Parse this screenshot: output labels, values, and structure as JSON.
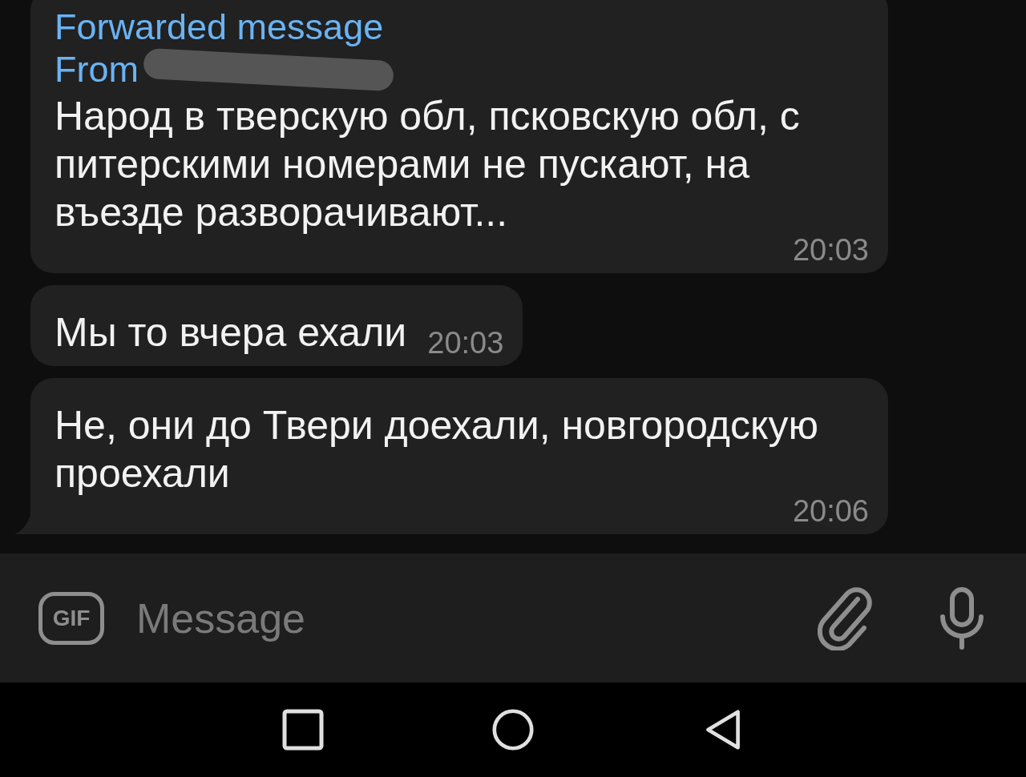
{
  "messages": [
    {
      "kind": "forwarded",
      "forward_title": "Forwarded message",
      "forward_from": "From",
      "from_redacted": true,
      "lines": [
        "Народ в тверскую обл, псковскую обл,  с",
        "питерскими номерами не пускают,  на",
        "въезде разворачивают..."
      ],
      "time": "20:03",
      "tail": false
    },
    {
      "kind": "plain",
      "lines": [
        "Мы то вчера ехали"
      ],
      "time": "20:03",
      "tail": false
    },
    {
      "kind": "plain",
      "lines": [
        "Не, они до Твери доехали, новгородскую",
        "проехали"
      ],
      "time": "20:06",
      "tail": true
    }
  ],
  "composer": {
    "gif_label": "GIF",
    "placeholder": "Message"
  }
}
